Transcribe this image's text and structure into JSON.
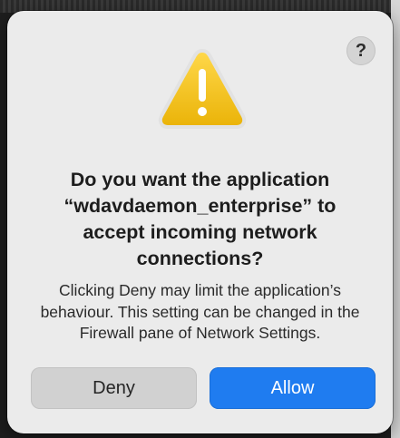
{
  "dialog": {
    "help_label": "?",
    "title": "Do you want the application “wdavdaemon_enterprise” to accept incoming network connections?",
    "message": "Clicking Deny may limit the application’s behaviour. This setting can be changed in the Firewall pane of Network Settings.",
    "icon": "warning-icon",
    "buttons": {
      "deny_label": "Deny",
      "allow_label": "Allow"
    }
  },
  "colors": {
    "accent": "#1f7cf0",
    "warning": "#f2c21c",
    "dialog_background": "#ebebeb"
  }
}
